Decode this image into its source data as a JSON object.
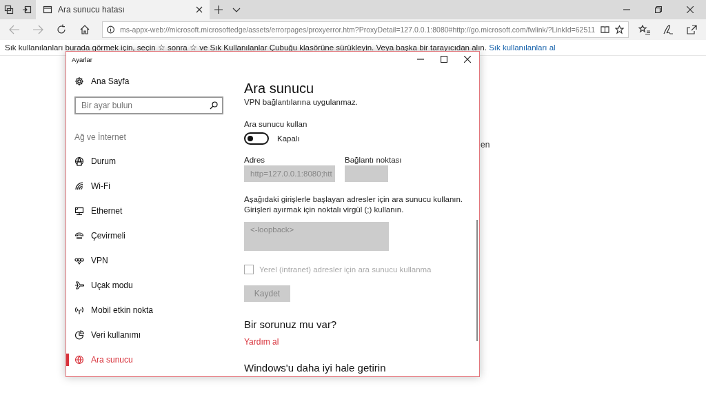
{
  "browser": {
    "tabs": [
      {
        "title": "Ara sunucu hatası",
        "selected": true
      }
    ],
    "address_bar": {
      "url": "ms-appx-web://microsoft.microsoftedge/assets/errorpages/proxyerror.htm?ProxyDetail=127.0.0.1:8080#http://go.microsoft.com/fwlink/?LinkId=62511"
    },
    "favorites_bar": {
      "message": "Sık kullanılanları burada görmek için, seçin ☆ sonra ☆ ve Sık Kullanılanlar Çubuğu klasörüne sürükleyin. Veya başka bir tarayıcıdan alın.",
      "link": "Sık kullanılanları al"
    },
    "page": {
      "text_fragment": "en"
    }
  },
  "settings_window": {
    "title": "Ayarlar",
    "home": "Ana Sayfa",
    "search": {
      "placeholder": "Bir ayar bulun"
    },
    "section": "Ağ ve İnternet",
    "nav_items": [
      {
        "label": "Durum",
        "selected": false
      },
      {
        "label": "Wi-Fi",
        "selected": false
      },
      {
        "label": "Ethernet",
        "selected": false
      },
      {
        "label": "Çevirmeli",
        "selected": false
      },
      {
        "label": "VPN",
        "selected": false
      },
      {
        "label": "Uçak modu",
        "selected": false
      },
      {
        "label": "Mobil etkin nokta",
        "selected": false
      },
      {
        "label": "Veri kullanımı",
        "selected": false
      },
      {
        "label": "Ara sunucu",
        "selected": true
      }
    ],
    "content": {
      "title": "Ara sunucu",
      "intro_fragment": "VPN bağlantılarına uygulanmaz.",
      "proxy_toggle": {
        "label": "Ara sunucu kullan",
        "on": false,
        "state_text": "Kapalı"
      },
      "address": {
        "label": "Adres",
        "value": "http=127.0.0.1:8080;htt",
        "disabled": true
      },
      "port": {
        "label": "Bağlantı noktası",
        "disabled": true
      },
      "exceptions_help": [
        "Aşağıdaki girişlerle başlayan adresler için ara sunucu kullanın.",
        "Girişleri ayırmak için noktalı virgül (;) kullanın."
      ],
      "exceptions": {
        "value": "<-loopback>",
        "disabled": true
      },
      "local_checkbox": {
        "label": "Yerel (intranet) adresler için ara sunucu kullanma",
        "checked": false,
        "disabled": true
      },
      "save_button": {
        "label": "Kaydet",
        "disabled": true
      },
      "help_heading": "Bir sorunuz mu var?",
      "help_link": "Yardım al",
      "footer_heading": "Windows'u daha iyi hale getirin"
    }
  }
}
